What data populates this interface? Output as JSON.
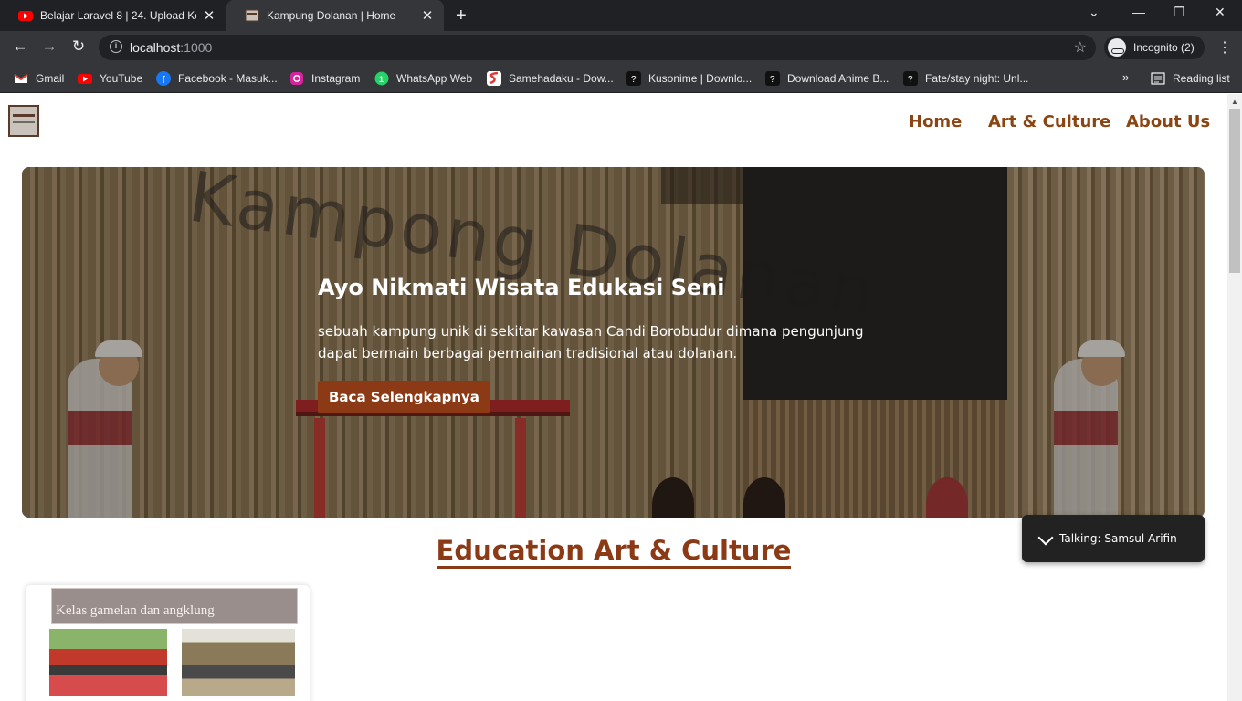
{
  "browser": {
    "tabs": [
      {
        "title": "Belajar Laravel 8 | 24. Upload Ke …",
        "favicon": "youtube-icon"
      },
      {
        "title": "Kampung Dolanan | Home",
        "favicon": "page-icon"
      }
    ],
    "url_host": "localhost",
    "url_port": ":1000",
    "incognito_label": "Incognito (2)",
    "bookmarks": [
      {
        "label": "Gmail",
        "icon": "gmail-icon",
        "color": "#ea4335"
      },
      {
        "label": "YouTube",
        "icon": "youtube-icon",
        "color": "#ff0000"
      },
      {
        "label": "Facebook - Masuk...",
        "icon": "facebook-icon",
        "color": "#1877f2"
      },
      {
        "label": "Instagram",
        "icon": "instagram-icon",
        "color": "#d6249f"
      },
      {
        "label": "WhatsApp Web",
        "icon": "whatsapp-icon",
        "color": "#25d366"
      },
      {
        "label": "Samehadaku - Dow...",
        "icon": "samehadaku-icon",
        "color": "#e53935"
      },
      {
        "label": "Kusonime | Downlo...",
        "icon": "unknown-site-icon",
        "color": "#111111"
      },
      {
        "label": "Download Anime B...",
        "icon": "unknown-site-icon",
        "color": "#111111"
      },
      {
        "label": "Fate/stay night: Unl...",
        "icon": "unknown-site-icon",
        "color": "#111111"
      }
    ],
    "reading_list": "Reading list"
  },
  "site": {
    "nav": [
      "Home",
      "Art & Culture",
      "About Us"
    ],
    "hero": {
      "title": "Ayo Nikmati Wisata Edukasi Seni",
      "description": "sebuah kampung unik di sekitar kawasan Candi Borobudur dimana pengunjung dapat bermain berbagai permainan tradisional atau dolanan.",
      "button": "Baca Selengkapnya",
      "sign_text": "Kampong Dolanan"
    },
    "section_title": "Education Art & Culture",
    "card": {
      "banner": "Kelas gamelan dan angklung"
    },
    "chat": "Talking: Samsul Arifin"
  },
  "colors": {
    "brand": "#8b3a15",
    "nav": "#8b4513"
  }
}
